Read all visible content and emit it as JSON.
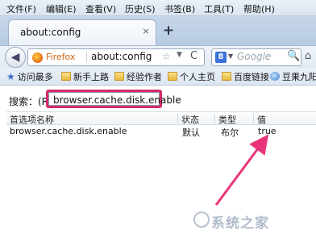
{
  "menubar": {
    "items": [
      "文件(F)",
      "编辑(E)",
      "查看(V)",
      "历史(S)",
      "书签(B)",
      "工具(T)",
      "帮助(H)"
    ]
  },
  "tab": {
    "title": "about:config",
    "close": "×",
    "new_tab": "+"
  },
  "navbar": {
    "back": "◀",
    "identity_label": "Firefox",
    "url": "about:config",
    "star": "☆",
    "dropdown": "▼",
    "reload": "C",
    "search_engine_letter": "8",
    "search_dropdown": "▼",
    "search_placeholder": "Google",
    "search_button": "🔍",
    "home": "⌂"
  },
  "bookmarks": {
    "items": [
      {
        "label": "访问最多",
        "icon": "star-icon"
      },
      {
        "label": "新手上路",
        "icon": "folder-icon"
      },
      {
        "label": "经验作者",
        "icon": "folder-icon"
      },
      {
        "label": "个人主页",
        "icon": "folder-icon"
      },
      {
        "label": "百度链接",
        "icon": "folder-icon"
      },
      {
        "label": "豆果九阳",
        "icon": "globe-icon"
      }
    ]
  },
  "config": {
    "search_label": "搜索：(R)",
    "search_value": "browser.cache.disk.enable",
    "highlight_color": "#d62a6e",
    "columns": [
      "首选项名称",
      "状态",
      "类型",
      "值"
    ],
    "rows": [
      {
        "name": "browser.cache.disk.enable",
        "status": "默认",
        "type": "布尔",
        "value": "true"
      }
    ]
  },
  "watermark": {
    "text": "系统之家"
  },
  "colors": {
    "arrow": "#e8357a",
    "chrome": "#dbe5f1"
  }
}
